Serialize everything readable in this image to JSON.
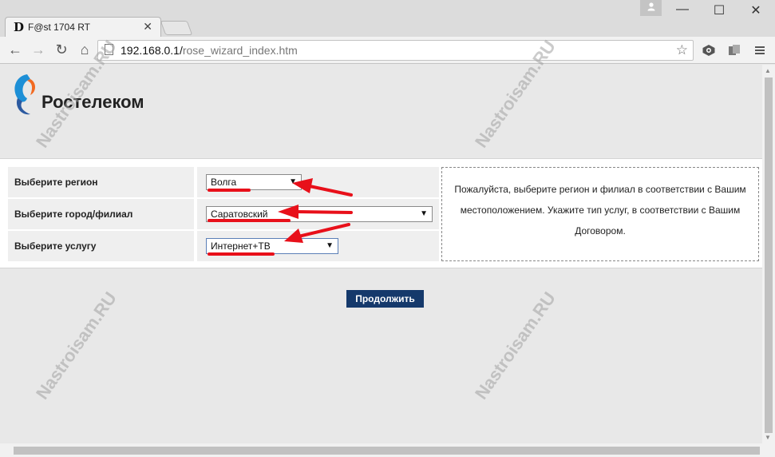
{
  "tab": {
    "favicon": "D",
    "title": "F@st 1704 RT",
    "close": "✕"
  },
  "window": {
    "profile_icon": "person-icon",
    "minimize": "—",
    "maximize": "☐",
    "close": "✕"
  },
  "toolbar": {
    "back": "←",
    "forward": "→",
    "reload": "↻",
    "home": "⌂",
    "url_host": "192.168.0.1/",
    "url_path": "rose_wizard_index.htm",
    "bookmark": "☆"
  },
  "logo": {
    "text": "Ростелеком"
  },
  "form": {
    "rows": [
      {
        "label": "Выберите регион",
        "value": "Волга"
      },
      {
        "label": "Выберите город/филиал",
        "value": "Саратовский"
      },
      {
        "label": "Выберите услугу",
        "value": "Интернет+ТВ"
      }
    ],
    "help_text": "Пожалуйста, выберите регион и филиал в соответствии с Вашим местоположением. Укажите тип услуг, в соответствии с Вашим Договором."
  },
  "continue_label": "Продолжить",
  "watermark": "Nastroisam.RU",
  "colors": {
    "button": "#15396b",
    "annotation": "#e8101a"
  }
}
